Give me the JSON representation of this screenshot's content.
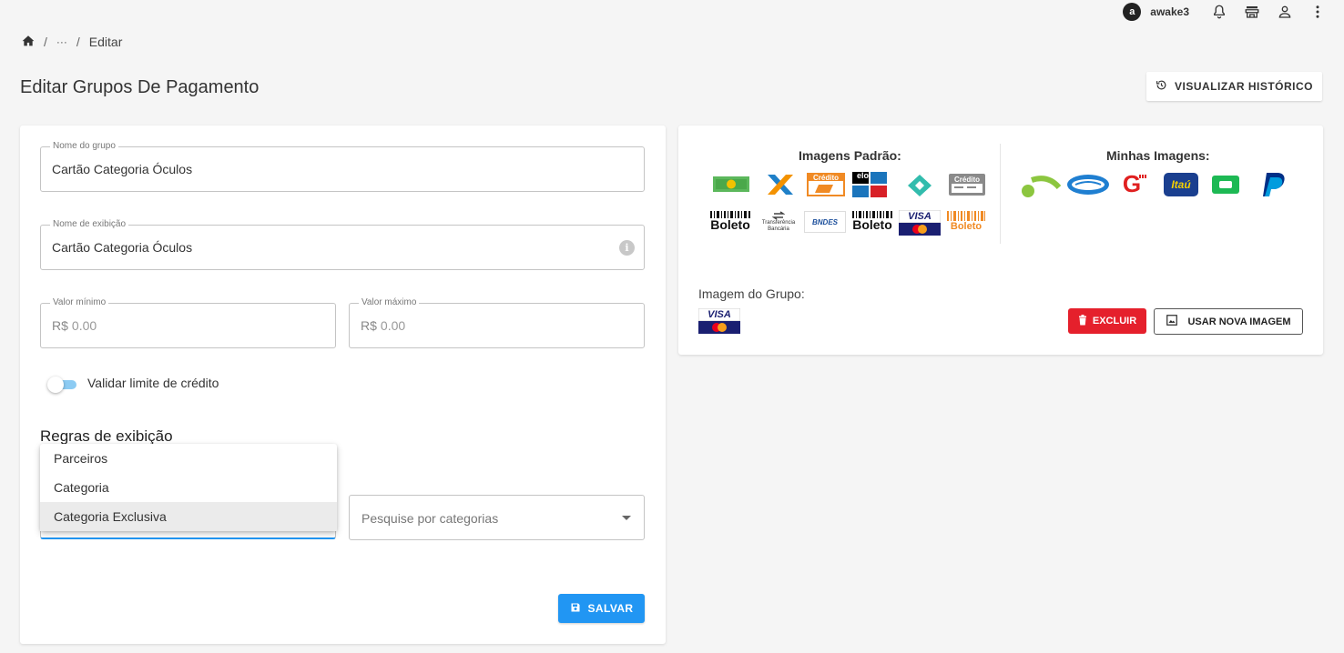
{
  "topbar": {
    "avatar_letter": "a",
    "username": "awake3",
    "icons": [
      "bell-icon",
      "store-icon",
      "user-icon",
      "more-vert-icon"
    ]
  },
  "breadcrumb": {
    "home_icon": "home-icon",
    "ellipsis": "···",
    "current": "Editar"
  },
  "page": {
    "title": "Editar Grupos De Pagamento",
    "history_button": "VISUALIZAR HISTÓRICO"
  },
  "form": {
    "group_name": {
      "label": "Nome do grupo",
      "value": "Cartão Categoria Óculos"
    },
    "display_name": {
      "label": "Nome de exibição",
      "value": "Cartão Categoria Óculos"
    },
    "min_value": {
      "label": "Valor mínimo",
      "prefix": "R$",
      "placeholder": "0.00"
    },
    "max_value": {
      "label": "Valor máximo",
      "prefix": "R$",
      "placeholder": "0.00"
    },
    "credit_toggle_label": "Validar limite de crédito",
    "rules_title": "Regras de exibição",
    "rule_options": [
      "Parceiros",
      "Categoria",
      "Categoria Exclusiva"
    ],
    "hovered_option": "Categoria Exclusiva",
    "category_search_placeholder": "Pesquise por categorias",
    "save_button": "SALVAR"
  },
  "images": {
    "default_title": "Imagens Padrão:",
    "mine_title": "Minhas Imagens:",
    "default_images": [
      {
        "name": "cash",
        "text": ""
      },
      {
        "name": "x-logo",
        "text": ""
      },
      {
        "name": "credito-orange",
        "text": "Crédito"
      },
      {
        "name": "elo-hipercard",
        "text": "elo"
      },
      {
        "name": "pix",
        "text": ""
      },
      {
        "name": "credito-gray",
        "text": "Crédito"
      },
      {
        "name": "boleto-black",
        "text": "Boleto"
      },
      {
        "name": "transferencia",
        "text": "Transferência Bancária"
      },
      {
        "name": "bndes",
        "text": "BNDES"
      },
      {
        "name": "boleto-black-2",
        "text": "Boleto"
      },
      {
        "name": "visa-mastercard",
        "text": "VISA"
      },
      {
        "name": "boleto-orange",
        "text": "Boleto"
      }
    ],
    "my_images": [
      {
        "name": "green-arc",
        "text": ""
      },
      {
        "name": "handshake-blue",
        "text": ""
      },
      {
        "name": "g-red",
        "text": "G"
      },
      {
        "name": "itau",
        "text": "Itaú"
      },
      {
        "name": "a-green",
        "text": "a"
      },
      {
        "name": "paypal",
        "text": "P"
      }
    ],
    "group_image_label": "Imagem do Grupo:",
    "group_image_text": "VISA",
    "delete_button": "EXCLUIR",
    "new_image_button": "USAR NOVA IMAGEM"
  },
  "colors": {
    "accent": "#2196f3",
    "danger": "#e5202c"
  }
}
